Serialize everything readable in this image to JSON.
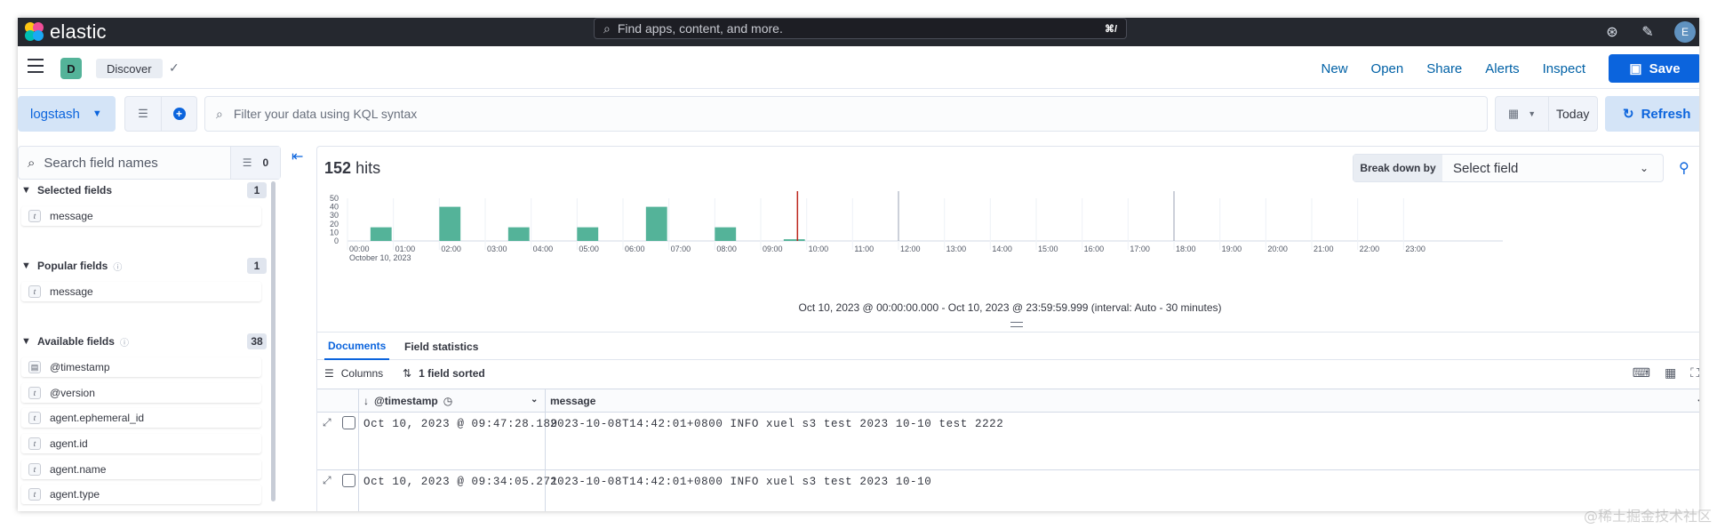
{
  "header": {
    "brand": "elastic",
    "search_placeholder": "Find apps, content, and more.",
    "search_shortcut": "⌘/",
    "user_initial": "E"
  },
  "appbar": {
    "space_initial": "D",
    "breadcrumb": "Discover",
    "links": [
      "New",
      "Open",
      "Share",
      "Alerts",
      "Inspect"
    ],
    "save_label": "Save"
  },
  "querybar": {
    "data_view": "logstash",
    "kql_placeholder": "Filter your data using KQL syntax",
    "date_label": "Today",
    "refresh_label": "Refresh"
  },
  "sidebar": {
    "search_placeholder": "Search field names",
    "filter_count": "0",
    "selected": {
      "title": "Selected fields",
      "count": "1",
      "items": [
        "message"
      ]
    },
    "popular": {
      "title": "Popular fields",
      "count": "1",
      "items": [
        "message"
      ]
    },
    "available": {
      "title": "Available fields",
      "count": "38",
      "items": [
        {
          "name": "@timestamp",
          "type": "date"
        },
        {
          "name": "@version",
          "type": "t"
        },
        {
          "name": "agent.ephemeral_id",
          "type": "t"
        },
        {
          "name": "agent.id",
          "type": "t"
        },
        {
          "name": "agent.name",
          "type": "t"
        },
        {
          "name": "agent.type",
          "type": "t"
        }
      ]
    }
  },
  "main": {
    "hits_count": "152",
    "hits_label": "hits",
    "breakdown_label": "Break down by",
    "breakdown_select": "Select field",
    "interval_text": "Oct 10, 2023 @ 00:00:00.000 - Oct 10, 2023 @ 23:59:59.999 (interval: Auto - 30 minutes)",
    "tabs": [
      "Documents",
      "Field statistics"
    ],
    "columns_label": "Columns",
    "sorted_label": "1 field sorted",
    "col_timestamp": "@timestamp",
    "col_message": "message",
    "rows": [
      {
        "timestamp": "Oct 10, 2023 @ 09:47:28.189",
        "message": "2023-10-08T14:42:01+0800 INFO xuel s3 test 2023 10-10 test 2222"
      },
      {
        "timestamp": "Oct 10, 2023 @ 09:34:05.271",
        "message": "2023-10-08T14:42:01+0800 INFO xuel s3 test 2023 10-10"
      }
    ]
  },
  "chart_data": {
    "type": "bar",
    "y_ticks": [
      "50",
      "40",
      "30",
      "20",
      "10",
      "0"
    ],
    "ylim": [
      0,
      50
    ],
    "x_ticks": [
      "00:00",
      "01:00",
      "02:00",
      "03:00",
      "04:00",
      "05:00",
      "06:00",
      "07:00",
      "08:00",
      "09:00",
      "10:00",
      "11:00",
      "12:00",
      "13:00",
      "14:00",
      "15:00",
      "16:00",
      "17:00",
      "18:00",
      "19:00",
      "20:00",
      "21:00",
      "22:00",
      "23:00"
    ],
    "x_sublabel": "October 10, 2023",
    "bars": [
      {
        "start_hour": 0.5,
        "value": 16
      },
      {
        "start_hour": 2.0,
        "value": 40
      },
      {
        "start_hour": 3.5,
        "value": 16
      },
      {
        "start_hour": 5.0,
        "value": 16
      },
      {
        "start_hour": 6.5,
        "value": 40
      },
      {
        "start_hour": 8.0,
        "value": 16
      },
      {
        "start_hour": 9.5,
        "value": 2
      }
    ],
    "now_marker_hour": 9.8,
    "marker_hours": [
      12,
      18
    ],
    "bar_color": "#54b399",
    "now_color": "#bd271e"
  },
  "watermark": "@稀土掘金技术社区"
}
